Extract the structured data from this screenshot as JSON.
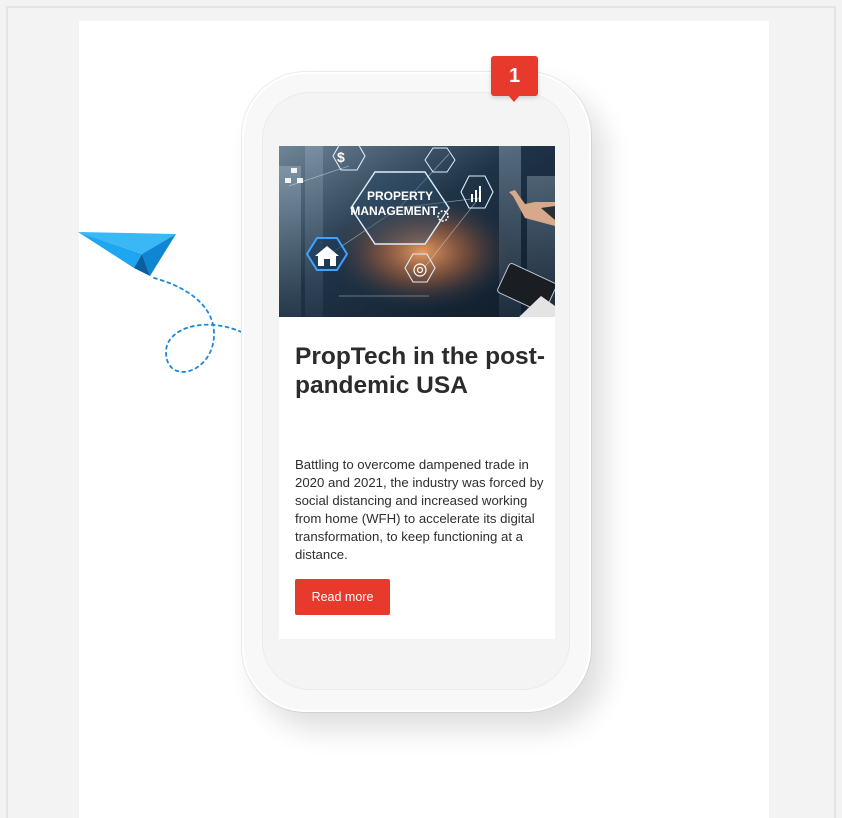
{
  "notification": {
    "count": "1"
  },
  "article": {
    "image_alt": "PROPERTY MANAGEMENT",
    "title": "PropTech in the post-pandemic USA",
    "body": "Battling to overcome dampened trade in 2020 and 2021, the industry was forced by social distancing and increased working from home (WFH) to accelerate its digital transformation, to keep functioning at a distance.",
    "cta_label": "Read more"
  },
  "colors": {
    "accent": "#e8392d",
    "plane": "#1ea7f0",
    "plane_dark": "#0b74c0",
    "page_bg": "#f3f3f4",
    "title": "#2b2b2b"
  },
  "icons": [
    "paper-plane-icon",
    "notification-badge"
  ]
}
